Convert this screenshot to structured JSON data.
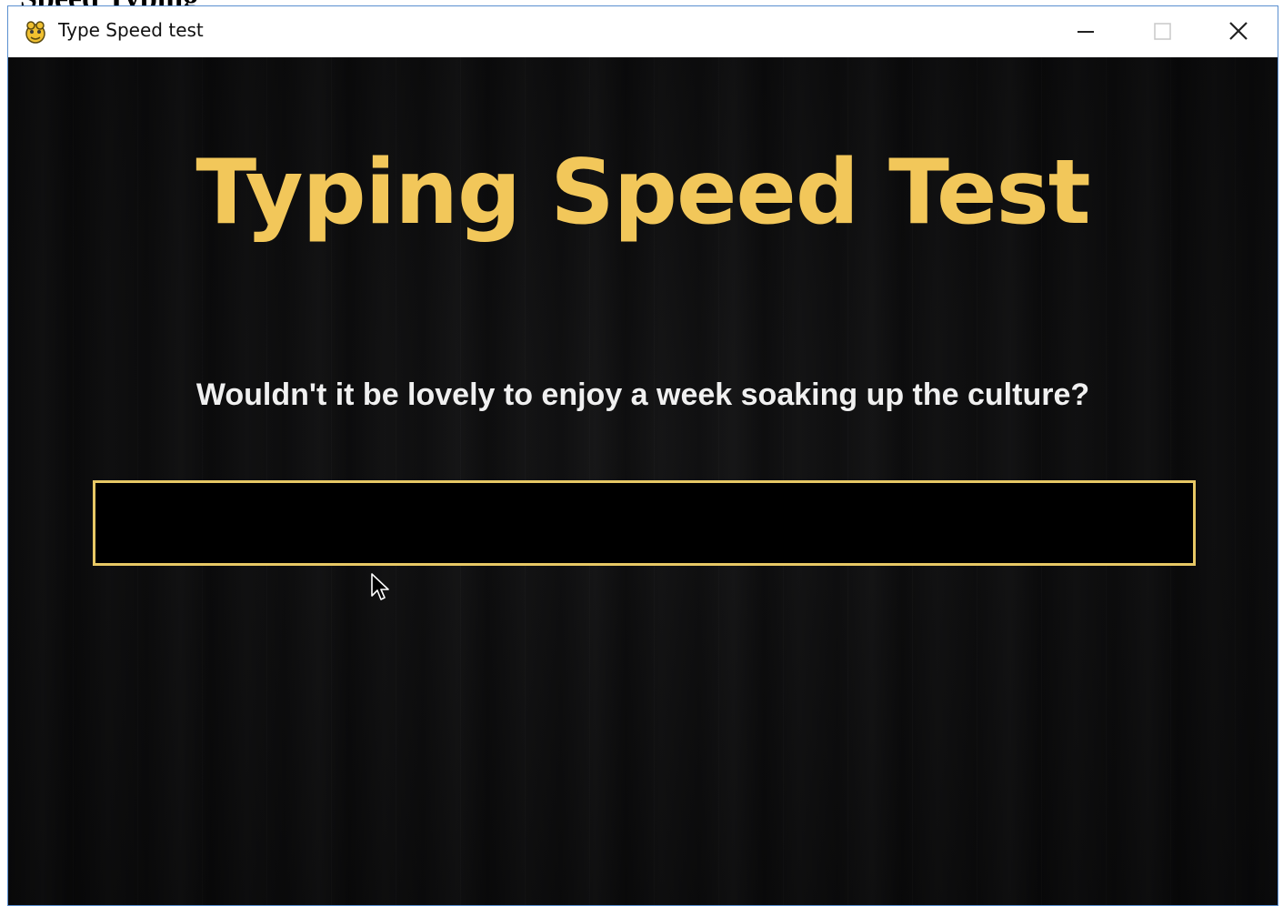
{
  "page_heading_fragment": "Speed Typing",
  "window": {
    "title": "Type Speed test",
    "icon": "pygame-snake-icon",
    "controls": {
      "minimize_icon": "minimize-icon",
      "maximize_icon": "maximize-icon",
      "close_icon": "close-icon"
    }
  },
  "game": {
    "heading": "Typing Speed Test",
    "sentence": "Wouldn't it be lovely to enjoy a week soaking up the culture?",
    "input_value": "",
    "colors": {
      "heading": "#f2c75a",
      "input_border": "#e7c865",
      "sentence": "#f0f0f0",
      "background": "#0d0d0e"
    }
  }
}
